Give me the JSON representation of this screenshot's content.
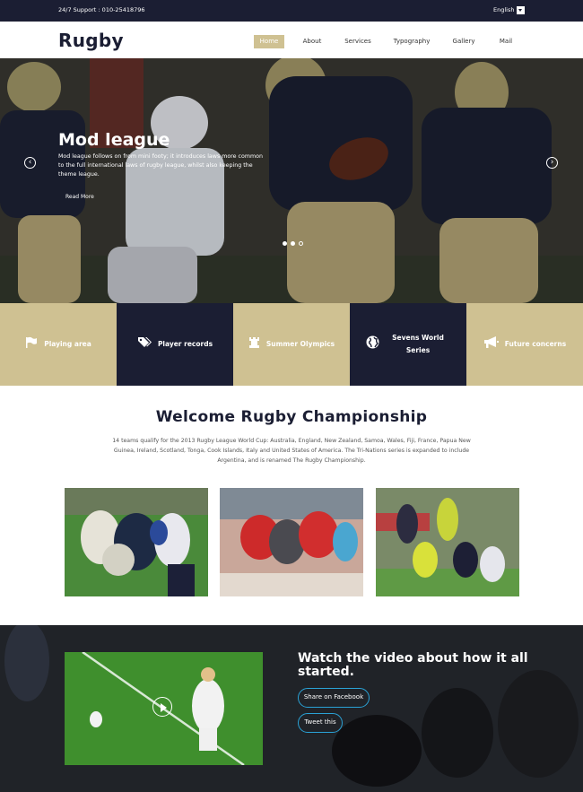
{
  "topbar": {
    "support": "24/7 Support : 010-25418796",
    "language": "English"
  },
  "nav": {
    "logo": "Rugby",
    "items": [
      {
        "label": "Home",
        "active": true
      },
      {
        "label": "About"
      },
      {
        "label": "Services"
      },
      {
        "label": "Typography"
      },
      {
        "label": "Gallery"
      },
      {
        "label": "Mail"
      }
    ]
  },
  "hero": {
    "title": "Mod league",
    "text": "Mod league follows on from mini footy; it introduces laws more common to the full international laws of rugby league, whilst also keeping the theme league.",
    "button": "Read More",
    "prev_icon": "chevron-left-icon",
    "next_icon": "chevron-right-icon"
  },
  "tiles": [
    {
      "label": "Playing area",
      "icon": "flag-icon"
    },
    {
      "label": "Player records",
      "icon": "tags-icon"
    },
    {
      "label": "Summer Olympics",
      "icon": "chess-rook-icon"
    },
    {
      "label": "Sevens World Series",
      "icon": "globe-icon"
    },
    {
      "label": "Future concerns",
      "icon": "bullhorn-icon"
    }
  ],
  "welcome": {
    "title": "Welcome Rugby Championship",
    "text": "14 teams qualify for the 2013 Rugby League World Cup: Australia, England, New Zealand, Samoa, Wales, Fiji, France, Papua New Guinea, Ireland, Scotland, Tonga, Cook Islands, Italy and United States of America. The Tri-Nations series is expanded to include Argentina, and is renamed The Rugby Championship."
  },
  "video": {
    "title": "Watch the video about how it all started.",
    "share_facebook": "Share on Facebook",
    "tweet": "Tweet this"
  },
  "colors": {
    "navy": "#1b1e33",
    "gold": "#cfc192",
    "accent": "#2aa2d6"
  }
}
